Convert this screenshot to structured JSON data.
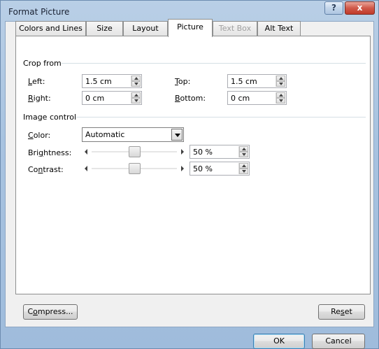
{
  "window": {
    "title": "Format Picture",
    "help_label": "?",
    "close_label": "x"
  },
  "tabs": [
    {
      "label": "Colors and Lines",
      "state": "normal"
    },
    {
      "label": "Size",
      "state": "normal"
    },
    {
      "label": "Layout",
      "state": "normal"
    },
    {
      "label": "Picture",
      "state": "active"
    },
    {
      "label": "Text Box",
      "state": "disabled"
    },
    {
      "label": "Alt Text",
      "state": "normal"
    }
  ],
  "crop": {
    "title": "Crop from",
    "left": {
      "label_pre": "",
      "label_u": "L",
      "label_post": "eft:",
      "value": "1.5 cm"
    },
    "top": {
      "label_pre": "",
      "label_u": "T",
      "label_post": "op:",
      "value": "1.5 cm"
    },
    "right": {
      "label_pre": "",
      "label_u": "R",
      "label_post": "ight:",
      "value": "0 cm"
    },
    "bottom": {
      "label_pre": "",
      "label_u": "B",
      "label_post": "ottom:",
      "value": "0 cm"
    }
  },
  "image_control": {
    "title": "Image control",
    "color": {
      "label_pre": "",
      "label_u": "C",
      "label_post": "olor:",
      "value": "Automatic"
    },
    "brightness": {
      "label_pre": "Bri",
      "label_u": "g",
      "label_post": "htness:",
      "value": "50 %",
      "level": 0.5
    },
    "contrast": {
      "label_pre": "Co",
      "label_u": "n",
      "label_post": "trast:",
      "value": "50 %",
      "level": 0.5
    }
  },
  "buttons": {
    "compress": {
      "pre": "C",
      "u": "o",
      "post": "mpress..."
    },
    "reset": {
      "pre": "Re",
      "u": "s",
      "post": "et"
    },
    "ok": "OK",
    "cancel": "Cancel"
  }
}
